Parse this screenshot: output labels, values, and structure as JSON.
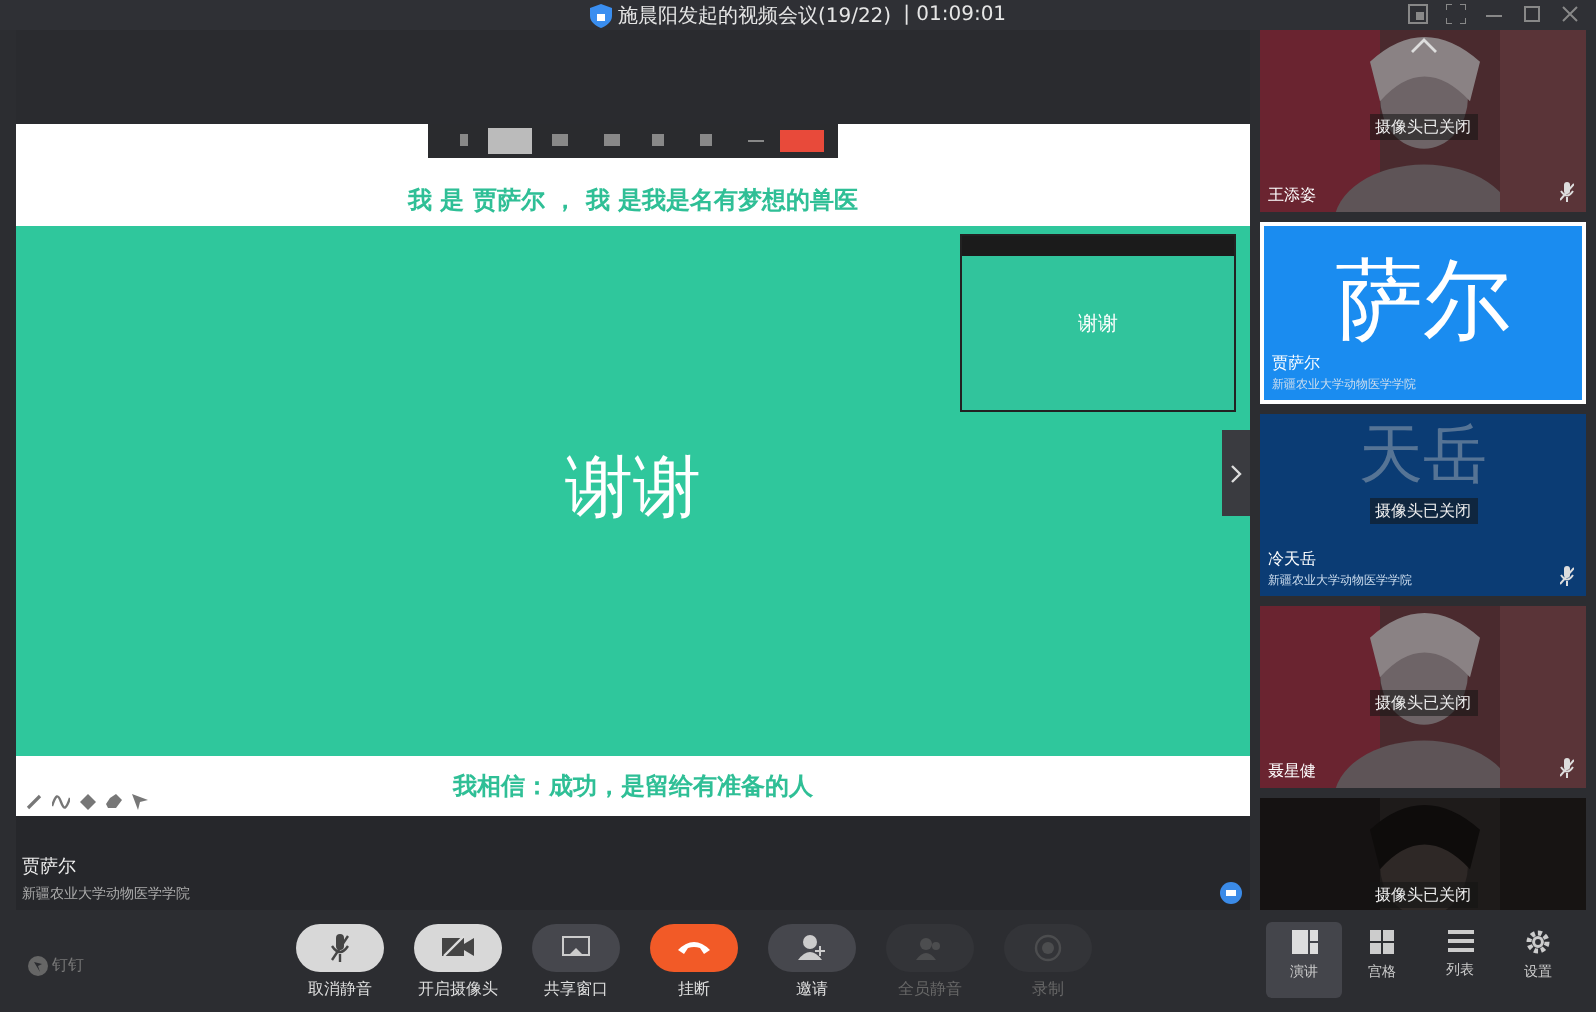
{
  "window": {
    "title": "施晨阳发起的视频会议(19/22)",
    "time": "| 01:09:01"
  },
  "slide": {
    "top_text": "我 是 贾萨尔 ， 我 是我是名有梦想的兽医",
    "big_text": "谢谢",
    "thumbnail_text": "谢谢",
    "bottom_text": "我相信：成功，是留给有准备的人"
  },
  "presenter": {
    "name": "贾萨尔",
    "org": "新疆农业大学动物医学学院"
  },
  "participants": [
    {
      "name": "王添姿",
      "status": "摄像头已关闭",
      "selected": false,
      "muted": true
    },
    {
      "kind": "avatar",
      "avatar_text": "萨尔",
      "color": "#1a8cf0",
      "name": "贾萨尔",
      "org": "新疆农业大学动物医学学院",
      "selected": true,
      "muted": false
    },
    {
      "kind": "avatar",
      "avatar_text": "天岳",
      "color": "#0b3c74",
      "status": "摄像头已关闭",
      "name": "冷天岳",
      "org": "新疆农业大学动物医学学院",
      "selected": false,
      "muted": true
    },
    {
      "name": "聂星健",
      "status": "摄像头已关闭",
      "selected": false,
      "muted": true
    },
    {
      "status": "摄像头已关闭",
      "selected": false,
      "muted": false
    }
  ],
  "controls": [
    {
      "kind": "mic",
      "label": "取消静音",
      "disabled": false
    },
    {
      "kind": "camera",
      "label": "开启摄像头",
      "disabled": false
    },
    {
      "kind": "share",
      "label": "共享窗口",
      "disabled": false
    },
    {
      "kind": "hangup",
      "label": "挂断",
      "disabled": false
    },
    {
      "kind": "invite",
      "label": "邀请",
      "disabled": false
    },
    {
      "kind": "muteall",
      "label": "全员静音",
      "disabled": true
    },
    {
      "kind": "record",
      "label": "录制",
      "disabled": true
    }
  ],
  "views": [
    {
      "kind": "speaker",
      "label": "演讲",
      "selected": true
    },
    {
      "kind": "grid",
      "label": "宫格",
      "selected": false
    },
    {
      "kind": "list",
      "label": "列表",
      "selected": false
    }
  ],
  "settings": {
    "label": "设置"
  },
  "brand": "钉钉"
}
